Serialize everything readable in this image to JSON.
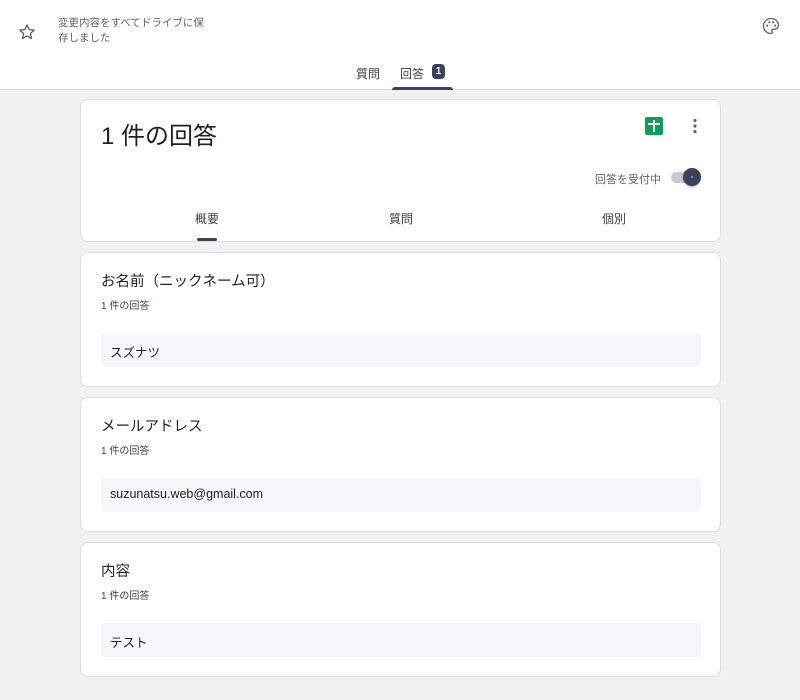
{
  "header": {
    "save_status": "変更内容をすべてドライブに保存しました",
    "tabs": [
      {
        "label": "質問"
      },
      {
        "label": "回答",
        "badge": "1"
      }
    ],
    "active_tab": "回答"
  },
  "summary": {
    "title": "1 件の回答",
    "accepting_label": "回答を受付中",
    "accepting": true,
    "tabs": [
      {
        "label": "概要"
      },
      {
        "label": "質問"
      },
      {
        "label": "個別"
      }
    ],
    "active_tab": "概要"
  },
  "questions": [
    {
      "title": "お名前（ニックネーム可）",
      "count": "1 件の回答",
      "answer": "スズナツ"
    },
    {
      "title": "メールアドレス",
      "count": "1 件の回答",
      "answer": "suzunatsu.web@gmail.com"
    },
    {
      "title": "内容",
      "count": "1 件の回答",
      "answer": "テスト"
    }
  ],
  "colors": {
    "accent": "#3c4259",
    "sheets_green": "#0f9d58",
    "background": "#f1f1f1"
  },
  "icons": {
    "star": "star-icon",
    "palette": "palette-icon",
    "sheets": "sheets-icon",
    "more": "more-vert-icon"
  }
}
